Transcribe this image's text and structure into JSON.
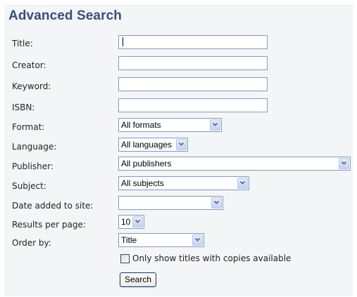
{
  "page": {
    "title": "Advanced Search"
  },
  "form": {
    "labels": {
      "title": "Title:",
      "creator": "Creator:",
      "keyword": "Keyword:",
      "isbn": "ISBN:",
      "format": "Format:",
      "language": "Language:",
      "publisher": "Publisher:",
      "subject": "Subject:",
      "date_added": "Date added to site:",
      "results_per_page": "Results per page:",
      "order_by": "Order by:"
    },
    "values": {
      "title": "",
      "creator": "",
      "keyword": "",
      "isbn": ""
    },
    "selects": {
      "format": "All formats",
      "language": "All languages",
      "publisher": "All publishers",
      "subject": "All subjects",
      "date_added": "",
      "results_per_page": "10",
      "order_by": "Title"
    },
    "checkbox_label": "Only show titles with copies available",
    "checkbox_checked": false,
    "search_button": "Search"
  },
  "colors": {
    "heading": "#35507a",
    "panel_background": "#f4f5f7",
    "input_border": "#7f9db9"
  }
}
